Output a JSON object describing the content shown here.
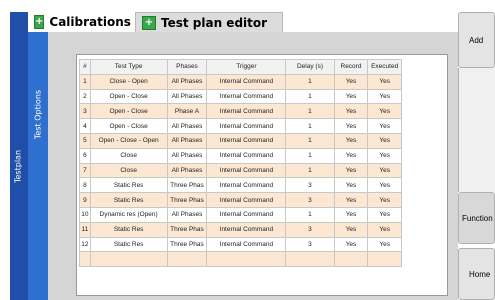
{
  "sidebar": {
    "main_label": "Testplan",
    "sub_label": "Test Options"
  },
  "tabs": [
    {
      "label": "Calibrations",
      "icon": "plus-icon"
    },
    {
      "label": "Test plan editor",
      "icon": "plus-icon"
    }
  ],
  "buttons": {
    "add": "Add",
    "function": "Function",
    "home": "Home"
  },
  "table": {
    "headers": [
      "#",
      "Test Type",
      "Phases",
      "Trigger",
      "Delay (s)",
      "Record",
      "Executed"
    ],
    "rows": [
      [
        "1",
        "Close - Open",
        "All Phases",
        "Internal Command",
        "1",
        "Yes",
        "Yes"
      ],
      [
        "2",
        "Open - Close",
        "All Phases",
        "Internal Command",
        "1",
        "Yes",
        "Yes"
      ],
      [
        "3",
        "Open - Close",
        "Phase A",
        "Internal Command",
        "1",
        "Yes",
        "Yes"
      ],
      [
        "4",
        "Open - Close",
        "All Phases",
        "Internal Command",
        "1",
        "Yes",
        "Yes"
      ],
      [
        "5",
        "Open - Close - Open",
        "All Phases",
        "Internal Command",
        "1",
        "Yes",
        "Yes"
      ],
      [
        "6",
        "Close",
        "All Phases",
        "Internal Command",
        "1",
        "Yes",
        "Yes"
      ],
      [
        "7",
        "Close",
        "All Phases",
        "Internal Command",
        "1",
        "Yes",
        "Yes"
      ],
      [
        "8",
        "Static Res",
        "Three Phas",
        "Internal Command",
        "3",
        "Yes",
        "Yes"
      ],
      [
        "9",
        "Static Res",
        "Three Phas",
        "Internal Command",
        "3",
        "Yes",
        "Yes"
      ],
      [
        "10",
        "Dynamic res (Open)",
        "All Phases",
        "Internal Command",
        "1",
        "Yes",
        "Yes"
      ],
      [
        "11",
        "Static Res",
        "Three Phas",
        "Internal Command",
        "3",
        "Yes",
        "Yes"
      ],
      [
        "12",
        "Static Res",
        "Three Phas",
        "Internal Command",
        "3",
        "Yes",
        "Yes"
      ],
      [
        "",
        "",
        "",
        "",
        "",
        "",
        ""
      ]
    ]
  },
  "colors": {
    "sidebar_main": "#1f4fa8",
    "sidebar_sub": "#2f6fd0",
    "row_highlight": "#fbe7d2",
    "tab_icon": "#3aa84a"
  }
}
